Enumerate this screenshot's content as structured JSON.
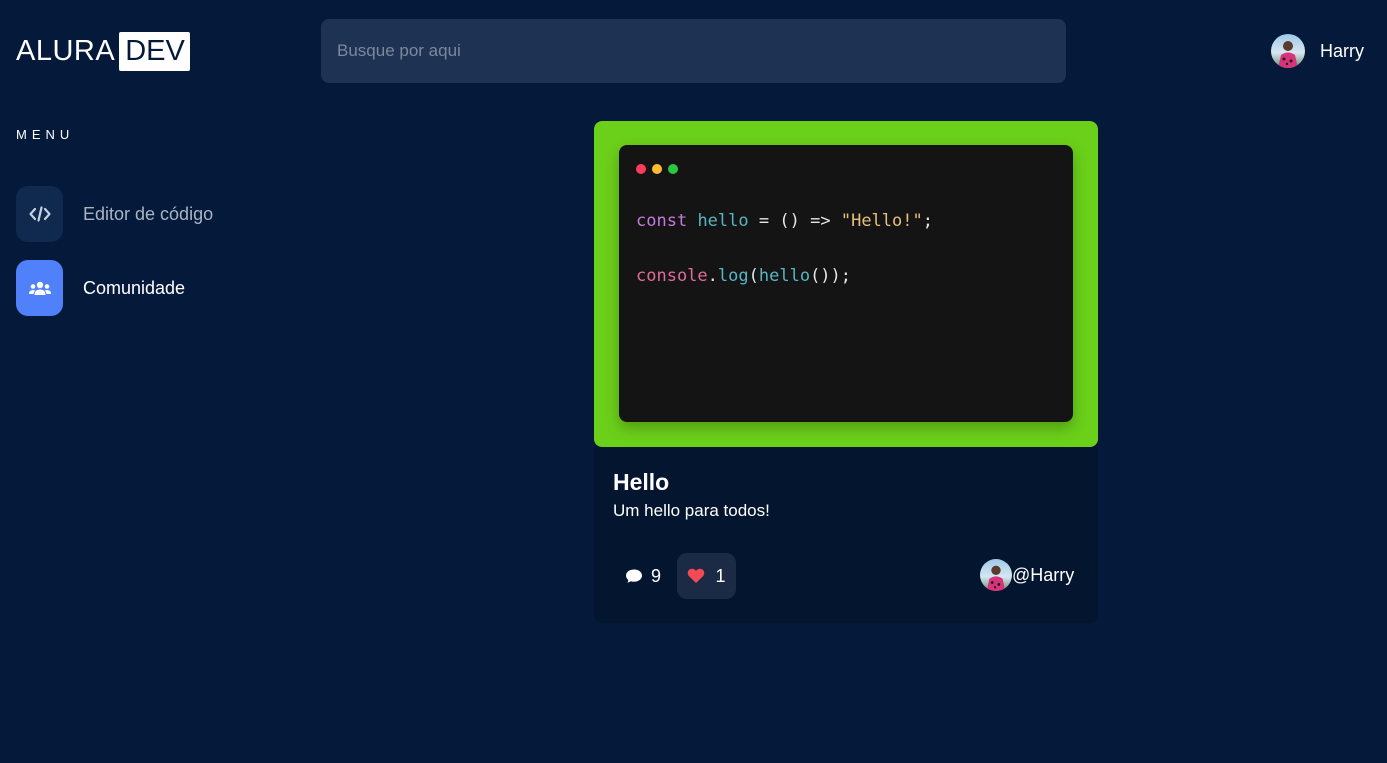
{
  "header": {
    "logo_text": "ALURA",
    "logo_badge": "DEV",
    "search": {
      "placeholder": "Busque por aqui",
      "value": ""
    },
    "user": {
      "name": "Harry"
    }
  },
  "sidebar": {
    "title": "MENU",
    "items": [
      {
        "label": "Editor de código",
        "icon": "code-icon",
        "active": false
      },
      {
        "label": "Comunidade",
        "icon": "users-icon",
        "active": true
      }
    ]
  },
  "post": {
    "background_color": "#6bd01a",
    "code_lines": [
      "const hello = () => \"Hello!\";",
      "",
      "console.log(hello());"
    ],
    "title": "Hello",
    "description": "Um hello para todos!",
    "comments_count": "9",
    "likes_count": "1",
    "author": "@Harry"
  },
  "colors": {
    "background": "#051a3a",
    "search_bg": "#1e3353",
    "accent_blue": "#5081fb",
    "card_bg": "#04162f",
    "code_bg": "#141414",
    "dot_red": "#ff3b5c",
    "dot_yellow": "#ffbd2e",
    "dot_green": "#28c840",
    "heart": "#f44a57"
  }
}
